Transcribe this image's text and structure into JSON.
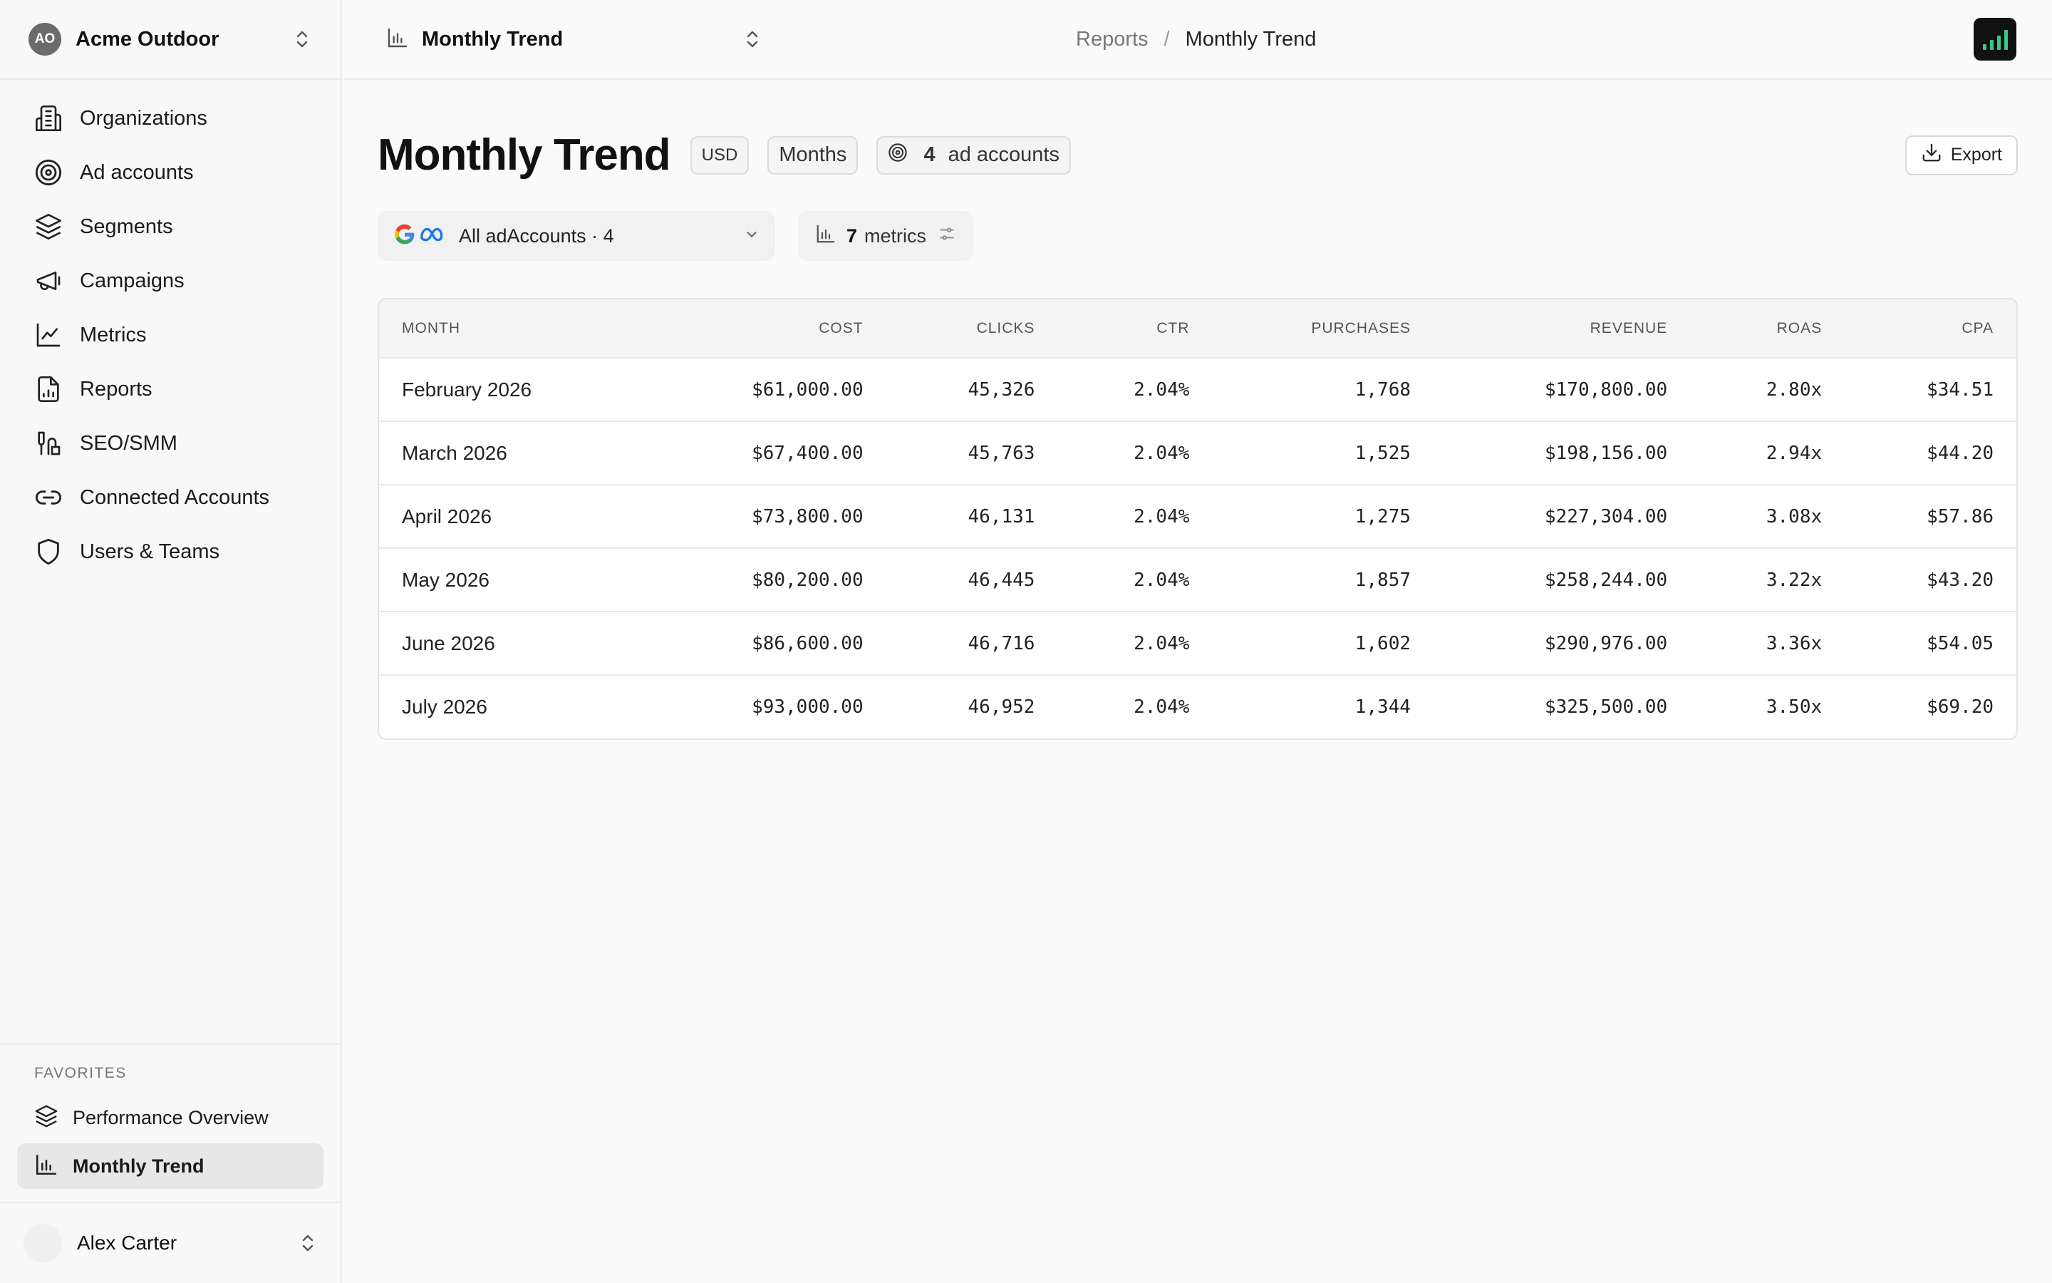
{
  "org": {
    "initials": "AO",
    "name": "Acme Outdoor"
  },
  "sidebar": {
    "items": [
      {
        "label": "Organizations",
        "icon": "building-icon"
      },
      {
        "label": "Ad accounts",
        "icon": "target-icon"
      },
      {
        "label": "Segments",
        "icon": "layers-icon"
      },
      {
        "label": "Campaigns",
        "icon": "megaphone-icon"
      },
      {
        "label": "Metrics",
        "icon": "line-chart-icon"
      },
      {
        "label": "Reports",
        "icon": "report-file-icon"
      },
      {
        "label": "SEO/SMM",
        "icon": "tools-icon"
      },
      {
        "label": "Connected Accounts",
        "icon": "link-icon"
      },
      {
        "label": "Users & Teams",
        "icon": "shield-icon"
      }
    ],
    "favorites_title": "FAVORITES",
    "favorites": [
      {
        "label": "Performance Overview",
        "icon": "layers-icon"
      },
      {
        "label": "Monthly Trend",
        "icon": "bar-chart-icon",
        "active": true
      }
    ]
  },
  "user": {
    "name": "Alex Carter"
  },
  "topbar": {
    "report_select": "Monthly Trend",
    "breadcrumb": [
      "Reports",
      "Monthly Trend"
    ]
  },
  "page": {
    "title": "Monthly Trend",
    "currency_chip": "USD",
    "granularity_chip": "Months",
    "accounts_count": "4",
    "accounts_label": "ad accounts",
    "export_label": "Export"
  },
  "filters": {
    "accounts_label": "All adAccounts · 4",
    "metrics_count": "7",
    "metrics_label": "metrics"
  },
  "table": {
    "columns": [
      "MONTH",
      "COST",
      "CLICKS",
      "CTR",
      "PURCHASES",
      "REVENUE",
      "ROAS",
      "CPA"
    ],
    "rows": [
      [
        "February 2026",
        "$61,000.00",
        "45,326",
        "2.04%",
        "1,768",
        "$170,800.00",
        "2.80x",
        "$34.51"
      ],
      [
        "March 2026",
        "$67,400.00",
        "45,763",
        "2.04%",
        "1,525",
        "$198,156.00",
        "2.94x",
        "$44.20"
      ],
      [
        "April 2026",
        "$73,800.00",
        "46,131",
        "2.04%",
        "1,275",
        "$227,304.00",
        "3.08x",
        "$57.86"
      ],
      [
        "May 2026",
        "$80,200.00",
        "46,445",
        "2.04%",
        "1,857",
        "$258,244.00",
        "3.22x",
        "$43.20"
      ],
      [
        "June 2026",
        "$86,600.00",
        "46,716",
        "2.04%",
        "1,602",
        "$290,976.00",
        "3.36x",
        "$54.05"
      ],
      [
        "July 2026",
        "$93,000.00",
        "46,952",
        "2.04%",
        "1,344",
        "$325,500.00",
        "3.50x",
        "$69.20"
      ]
    ]
  },
  "colors": {
    "accent_green": "#38c98a",
    "active_bg": "#e7e7e7"
  }
}
